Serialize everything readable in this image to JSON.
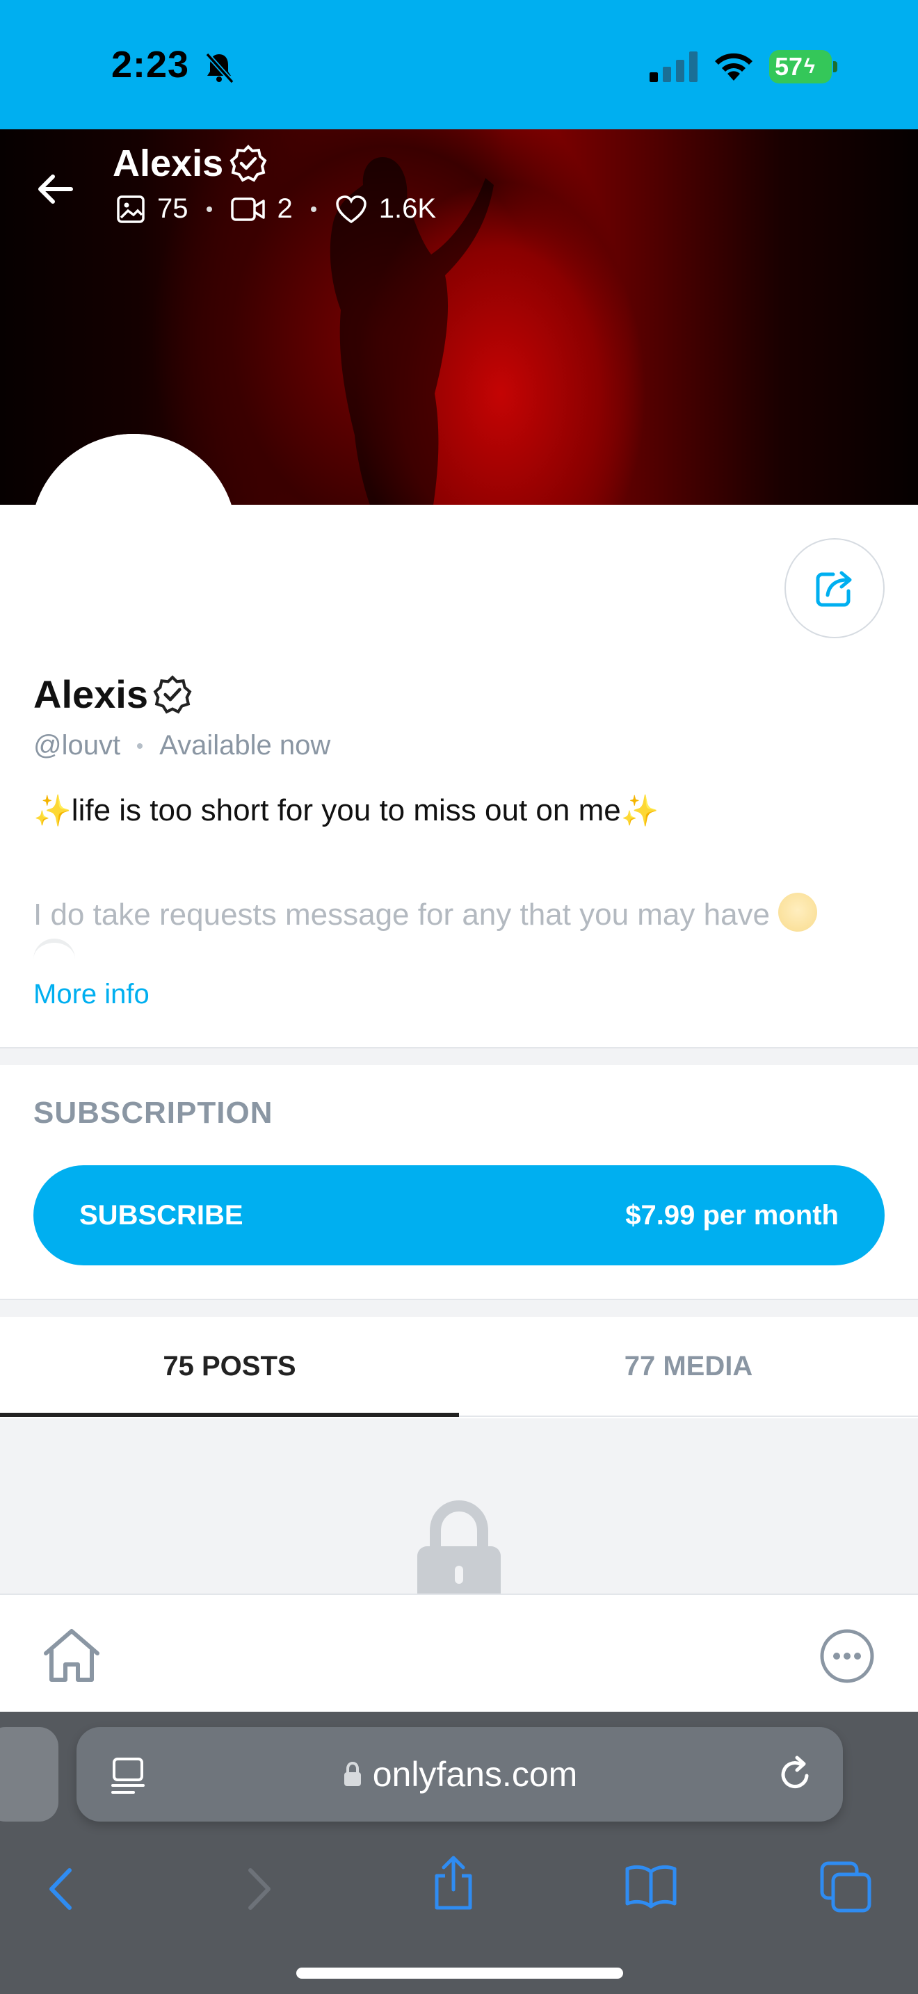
{
  "status_bar": {
    "time": "2:23",
    "battery": "57"
  },
  "header": {
    "title": "Alexis",
    "stats": {
      "photos": "75",
      "videos": "2",
      "likes": "1.6K"
    }
  },
  "profile": {
    "name": "Alexis",
    "handle": "@louvt",
    "availability": "Available now",
    "bio_line1": "life is too short for you to miss out on me",
    "bio_line2": "I do take requests message for any that you may have",
    "more_info": "More info"
  },
  "subscription": {
    "section_title": "SUBSCRIPTION",
    "button_label": "SUBSCRIBE",
    "price": "$7.99 per month"
  },
  "tabs": [
    {
      "label": "75 POSTS",
      "active": true
    },
    {
      "label": "77 MEDIA",
      "active": false
    }
  ],
  "browser": {
    "domain": "onlyfans.com"
  },
  "colors": {
    "brand": "#00aff0",
    "online": "#31c54b",
    "muted": "#8a96a3"
  },
  "icons": [
    "bell-slash-icon",
    "signal-icon",
    "wifi-icon",
    "battery-icon",
    "back-arrow-icon",
    "verified-icon",
    "image-icon",
    "video-icon",
    "heart-icon",
    "share-icon",
    "lock-icon",
    "home-icon",
    "more-icon",
    "reader-icon",
    "padlock-icon",
    "reload-icon",
    "back-icon",
    "forward-icon",
    "share-sheet-icon",
    "bookmarks-icon",
    "tabs-icon"
  ]
}
